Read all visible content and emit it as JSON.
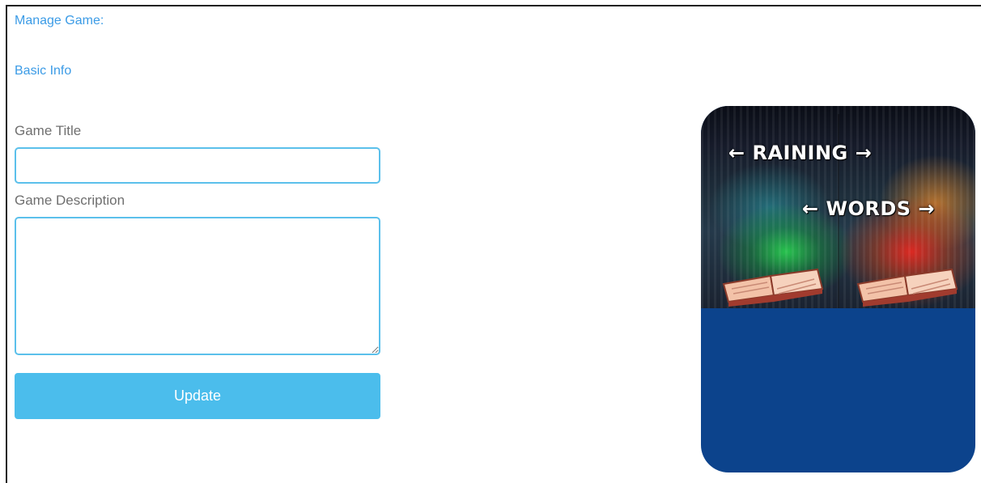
{
  "header": {
    "manage_label": "Manage Game:",
    "section_label": "Basic Info"
  },
  "form": {
    "title_label": "Game Title",
    "title_value": "",
    "description_label": "Game Description",
    "description_value": "",
    "update_label": "Update"
  },
  "preview": {
    "line1": "← RAINING →",
    "line2": "← WORDS →"
  },
  "colors": {
    "link": "#3b9be6",
    "field_border": "#5bc0eb",
    "button": "#4bbdec",
    "card_bg": "#0c438c"
  }
}
